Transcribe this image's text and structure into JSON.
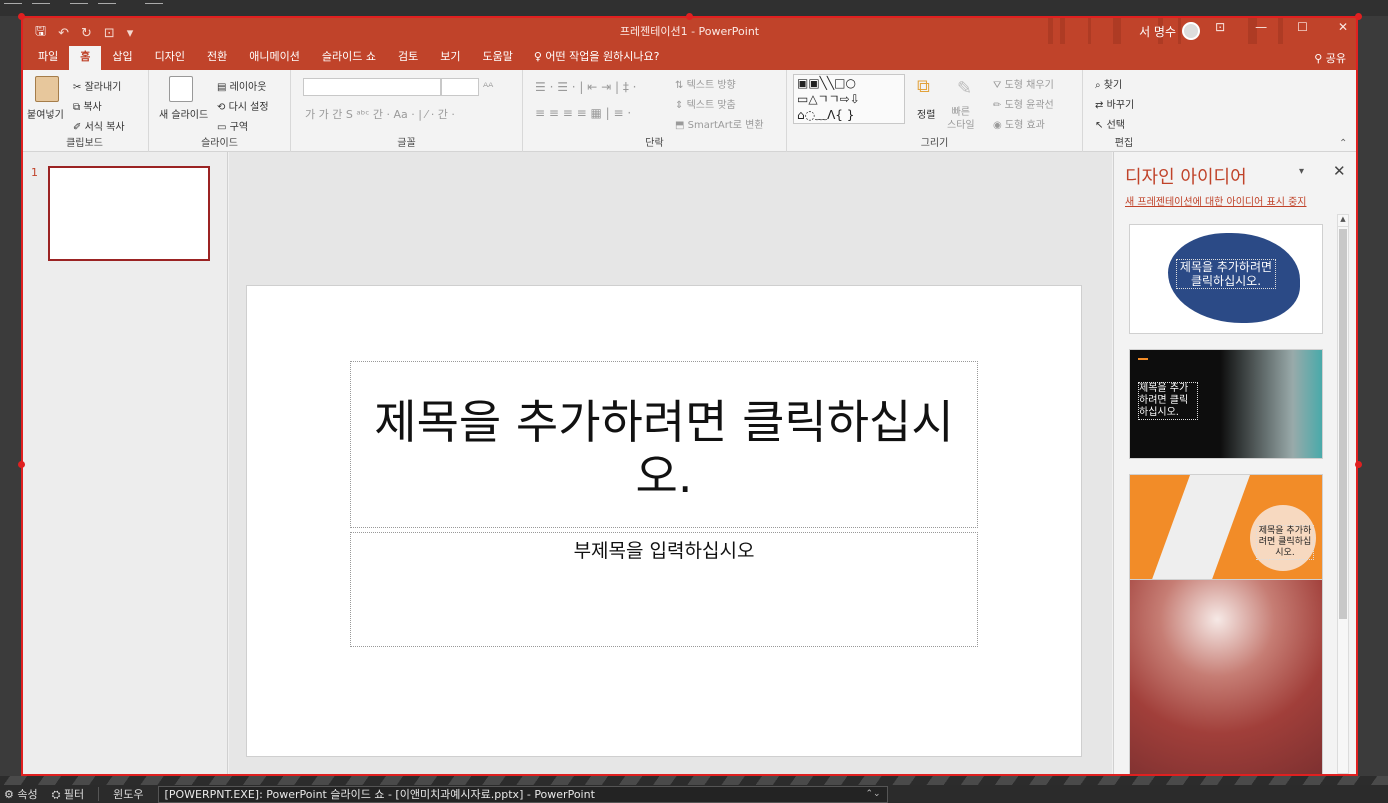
{
  "top_strip": {},
  "titlebar": {
    "title": "프레젠테이션1  -  PowerPoint",
    "user": "서 명수",
    "window_controls": [
      "⊡",
      "—",
      "☐",
      "✕"
    ]
  },
  "tabs": [
    "파일",
    "홈",
    "삽입",
    "디자인",
    "전환",
    "애니메이션",
    "슬라이드 쇼",
    "검토",
    "보기",
    "도움말"
  ],
  "tell_me": "어떤 작업을 원하시나요?",
  "share": "공유",
  "ribbon": {
    "clipboard": {
      "label": "클립보드",
      "paste": "붙여넣기",
      "cut": "잘라내기",
      "copy": "복사",
      "format_painter": "서식 복사"
    },
    "slides": {
      "label": "슬라이드",
      "new_slide": "새 슬라이드",
      "layout": "레이아웃",
      "reset": "다시 설정",
      "section": "구역"
    },
    "font": {
      "label": "글꼴"
    },
    "paragraph": {
      "label": "단락",
      "text_direction": "텍스트 방향",
      "align_text": "텍스트 맞춤",
      "smartart": "SmartArt로 변환"
    },
    "drawing": {
      "label": "그리기",
      "arrange": "정렬",
      "quick_styles": "빠른\n스타일",
      "fill": "도형 채우기",
      "outline": "도형 윤곽선",
      "effects": "도형 효과"
    },
    "editing": {
      "label": "편집",
      "find": "찾기",
      "replace": "바꾸기",
      "select": "선택"
    }
  },
  "thumbnail": {
    "number": "1"
  },
  "slide": {
    "title_placeholder": "제목을 추가하려면 클릭하십시오.",
    "subtitle_placeholder": "부제목을 입력하십시오"
  },
  "design_ideas": {
    "title": "디자인 아이디어",
    "stop_link": "새 프레젠테이션에 대한 아이디어 표시 중지",
    "idea1_text": "제목을 추가하려면 클릭하십시오.",
    "idea2_text": "제목을 추가하려면 클릭하십시오.",
    "idea3_text": "제목을 추가하려면 클릭하십시오."
  },
  "taskbar": {
    "properties": "속성",
    "filter": "필터",
    "window_label": "윈도우",
    "window_name": "[POWERPNT.EXE]: PowerPoint 슬라이드 쇼 - [이앤미치과예시자료.pptx] - PowerPoint"
  },
  "colors": {
    "accent": "#c0432a",
    "selection": "#e02020",
    "thumb_border": "#9b2323"
  }
}
